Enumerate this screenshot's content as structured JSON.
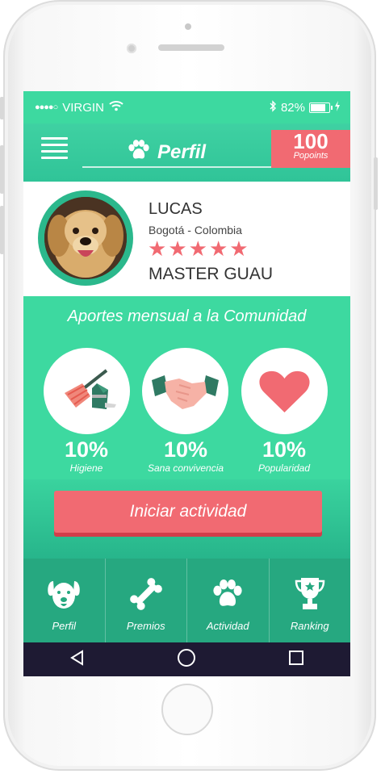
{
  "status_bar": {
    "signal_dots": "●●●●○",
    "carrier": "VIRGIN",
    "wifi_icon": "wifi-icon",
    "bluetooth_icon": "bluetooth-icon",
    "battery_percent": "82%",
    "charging_icon": "charging-icon"
  },
  "header": {
    "menu_icon": "hamburger-menu-icon",
    "title_icon": "paw-icon",
    "title": "Perfil",
    "points_value": "100",
    "points_label": "Popoints"
  },
  "profile": {
    "avatar": "dog-avatar",
    "name": "LUCAS",
    "location": "Bogotá - Colombia",
    "stars": 5,
    "rank": "MASTER GUAU"
  },
  "contributions": {
    "title": "Aportes mensual a la Comunidad",
    "items": [
      {
        "icon": "broom-dustpan-icon",
        "value": "10%",
        "label": "Higiene"
      },
      {
        "icon": "handshake-icon",
        "value": "10%",
        "label": "Sana convivencia"
      },
      {
        "icon": "heart-icon",
        "value": "10%",
        "label": "Popularidad"
      }
    ]
  },
  "action": {
    "button_label": "Iniciar actividad"
  },
  "tabs": [
    {
      "icon": "dog-face-icon",
      "label": "Perfil"
    },
    {
      "icon": "bone-icon",
      "label": "Premios"
    },
    {
      "icon": "paw-icon",
      "label": "Actividad"
    },
    {
      "icon": "trophy-icon",
      "label": "Ranking"
    }
  ],
  "nav": {
    "back_icon": "back-triangle-icon",
    "home_icon": "home-circle-icon",
    "recents_icon": "recents-square-icon"
  },
  "colors": {
    "primary_green": "#3dd9a0",
    "dark_green": "#26a880",
    "accent_red": "#f16a72",
    "nav_bar": "#1e1a33"
  }
}
